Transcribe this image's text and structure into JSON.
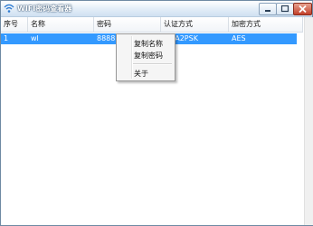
{
  "window": {
    "title": "WIFI密码查看器"
  },
  "table": {
    "columns": [
      "序号",
      "名称",
      "密码",
      "认证方式",
      "加密方式"
    ],
    "rows": [
      {
        "index": "1",
        "name": "wl",
        "password": "8888",
        "auth": "WPA2PSK",
        "encryption": "AES"
      }
    ]
  },
  "context_menu": {
    "items": [
      "复制名称",
      "复制密码",
      "关于"
    ]
  },
  "colors": {
    "selection": "#3399ff",
    "titlebar": "#cfe0f1",
    "close_button": "#c2402a"
  }
}
